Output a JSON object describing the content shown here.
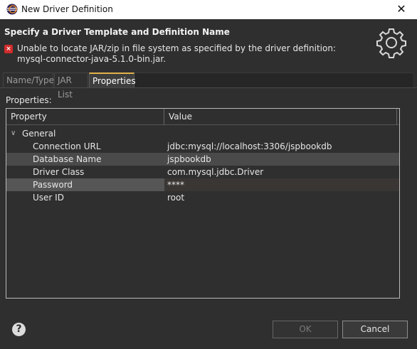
{
  "window": {
    "title": "New Driver Definition"
  },
  "header": {
    "heading": "Specify a Driver Template and Definition Name",
    "error_line1": "Unable to locate JAR/zip in file system as specified by the driver definition:",
    "error_line2": "mysql-connector-java-5.1.0-bin.jar.",
    "error_icon": "error-icon",
    "banner_icon": "gear-icon"
  },
  "tabs": [
    {
      "label": "Name/Type"
    },
    {
      "label": "JAR List"
    },
    {
      "label": "Properties"
    }
  ],
  "properties_label": "Properties:",
  "table": {
    "columns": [
      "Property",
      "Value"
    ],
    "group": "General",
    "rows": [
      {
        "property": "Connection URL",
        "value": "jdbc:mysql://localhost:3306/jspbookdb"
      },
      {
        "property": "Database Name",
        "value": "jspbookdb"
      },
      {
        "property": "Driver Class",
        "value": "com.mysql.jdbc.Driver"
      },
      {
        "property": "Password",
        "value": "****"
      },
      {
        "property": "User ID",
        "value": "root"
      }
    ]
  },
  "footer": {
    "ok_label": "OK",
    "cancel_label": "Cancel",
    "help_icon": "help-icon"
  },
  "colors": {
    "background": "#2f2f2f",
    "error": "#d12b2b",
    "active_tab_accent": "#e2b34a"
  }
}
